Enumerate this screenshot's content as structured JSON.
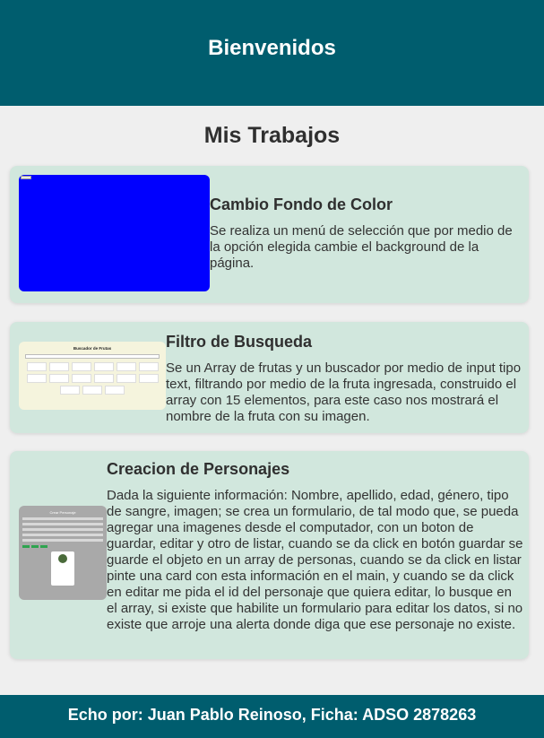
{
  "header": {
    "title": "Bienvenidos"
  },
  "main": {
    "section_title": "Mis Trabajos",
    "projects": [
      {
        "title": "Cambio Fondo de Color",
        "description": "Se realiza un menú de selección que por medio de la opción elegida cambie el background de la página.",
        "thumbnail": "blue-background-preview"
      },
      {
        "title": "Filtro de Busqueda",
        "description": "Se un Array de frutas y un buscador por medio de input tipo text, filtrando por medio de la fruta ingresada, construido el array con 15 elementos, para este caso nos mostrará el nombre de la fruta con su imagen.",
        "thumbnail": "fruit-search-preview",
        "thumbnail_title": "Buscador de Frutas"
      },
      {
        "title": "Creacion de Personajes",
        "description": "Dada la siguiente información: Nombre, apellido, edad, género, tipo de sangre, imagen; se crea un formulario, de tal modo que, se pueda agregar una imagenes desde el computador, con un boton de guardar, editar y otro de listar, cuando se da click en botón guardar se guarde el objeto en un array de personas, cuando se da click en listar pinte una card con esta información en el main, y cuando se da click en editar me pida el id del personaje que quiera editar, lo busque en el array, si existe que habilite un formulario para editar los datos, si no existe que arroje una alerta donde diga que ese personaje no existe.",
        "thumbnail": "character-form-preview",
        "thumbnail_title": "Crear Personaje"
      }
    ]
  },
  "footer": {
    "text": "Echo por: Juan Pablo Reinoso, Ficha: ADSO 2878263"
  },
  "colors": {
    "header_bg": "#005d6e",
    "card_bg": "#d1e7dd",
    "page_bg": "#efefef"
  }
}
